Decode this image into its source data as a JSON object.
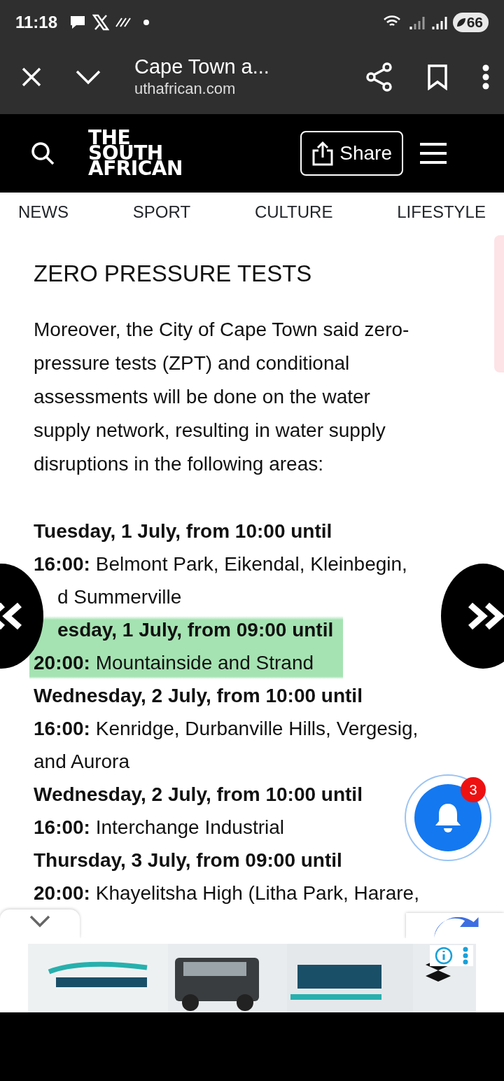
{
  "status_bar": {
    "time": "11:18",
    "battery": "66"
  },
  "browser": {
    "title": "Cape Town a...",
    "url": "uthafrican.com"
  },
  "site_header": {
    "logo": [
      "THE",
      "SOUTH",
      "AFRICAN"
    ],
    "share_label": "Share"
  },
  "nav": [
    {
      "label": "NEWS"
    },
    {
      "label": "SPORT"
    },
    {
      "label": "CULTURE"
    },
    {
      "label": "LIFESTYLE"
    }
  ],
  "article": {
    "heading": "ZERO PRESSURE TESTS",
    "intro": [
      "Moreover, the City of Cape Town said zero-",
      "pressure tests (ZPT) and conditional",
      "assessments will be done on the water",
      "supply network, resulting in water supply",
      "disruptions in the following areas:"
    ],
    "entries": [
      {
        "lines": [
          {
            "text": "**Tuesday, 1 July, from 10:00 until**",
            "covered_start": false
          },
          {
            "text": "**16:00:** Belmont Park, Eikendal, Kleinbegin,",
            "covered_start": false
          },
          {
            "text": "d Summerville",
            "covered_start": true
          }
        ],
        "highlighted": false
      },
      {
        "lines": [
          {
            "text": "**esday, 1 July, from 09:00 until**",
            "covered_start": true
          },
          {
            "text": "**20:00:** Mountainside and Strand",
            "covered_start": false
          }
        ],
        "highlighted": true
      },
      {
        "lines": [
          {
            "text": "**Wednesday, 2 July, from 10:00 until**",
            "covered_start": false
          },
          {
            "text": "**16:00:** Kenridge, Durbanville Hills, Vergesig,",
            "covered_start": false
          },
          {
            "text": "and Aurora",
            "covered_start": false
          }
        ],
        "highlighted": false
      },
      {
        "lines": [
          {
            "text": "**Wednesday, 2 July, from 10:00 until**",
            "covered_start": false
          },
          {
            "text": "**16:00:** Interchange Industrial",
            "covered_start": false
          }
        ],
        "highlighted": false
      },
      {
        "lines": [
          {
            "text": "**Thursday, 3 July, from 09:00 until**",
            "covered_start": false
          },
          {
            "text": "**20:00:** Khayelitsha High (Litha Park, Harare,",
            "covered_start": false
          }
        ],
        "highlighted": false
      }
    ]
  },
  "notification_badge": "3"
}
